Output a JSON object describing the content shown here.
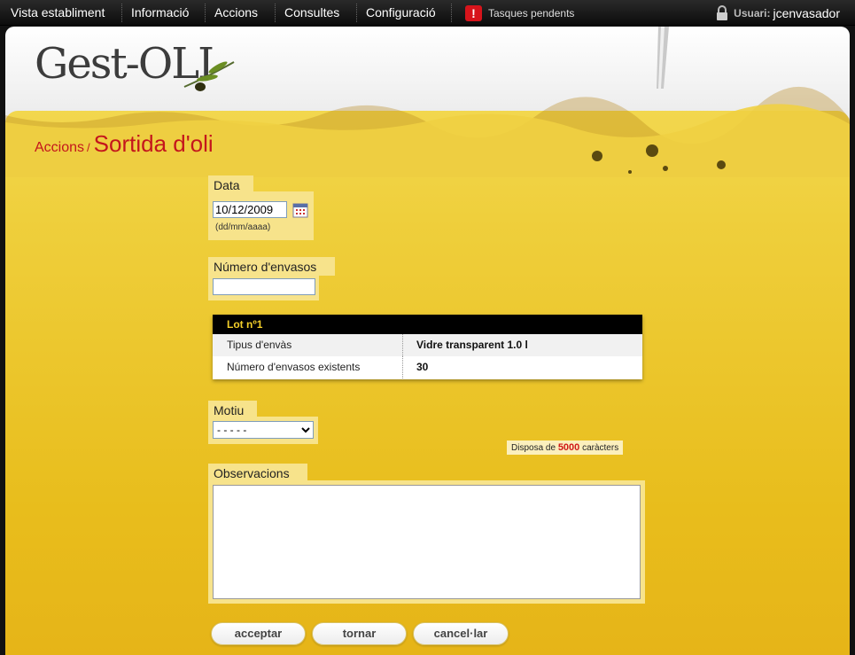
{
  "menu": {
    "items": [
      "Vista establiment",
      "Informació",
      "Accions",
      "Consultes",
      "Configuració"
    ],
    "tasks_label": "Tasques pendents",
    "tasks_icon": "!",
    "user_label": "Usuari:",
    "user_name": "jcenvasador"
  },
  "logo": {
    "text": "Gest-OLI"
  },
  "breadcrumb": {
    "parent": "Accions",
    "separator": "/",
    "current": "Sortida d'oli"
  },
  "form": {
    "date": {
      "label": "Data",
      "value": "10/12/2009",
      "hint": "(dd/mm/aaaa)"
    },
    "containers": {
      "label": "Número d'envasos",
      "value": ""
    },
    "lot": {
      "title": "Lot nº1",
      "rows": [
        {
          "key": "Tipus d'envàs",
          "value": "Vidre transparent 1.0 l"
        },
        {
          "key": "Número d'envasos existents",
          "value": "30"
        }
      ]
    },
    "reason": {
      "label": "Motiu",
      "selected": "- - - - -"
    },
    "notes": {
      "label": "Observacions",
      "value": "",
      "counter_prefix": "Disposa de",
      "counter_value": "5000",
      "counter_suffix": "caràcters"
    }
  },
  "buttons": {
    "accept": "acceptar",
    "back": "tornar",
    "cancel": "cancel·lar"
  },
  "colors": {
    "accent": "#c4161c",
    "oil": "#e8bd1c",
    "label_bg": "#f7e38b"
  }
}
